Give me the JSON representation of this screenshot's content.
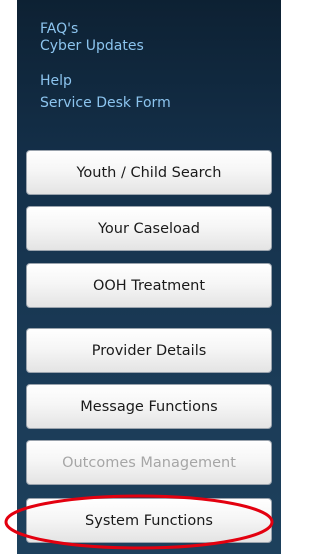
{
  "links": [
    {
      "label": "FAQ's"
    },
    {
      "label": "Cyber Updates"
    },
    {
      "label": "Help"
    },
    {
      "label": "Service Desk Form"
    }
  ],
  "menu": [
    {
      "label": "Youth / Child Search",
      "enabled": true
    },
    {
      "label": "Your Caseload",
      "enabled": true
    },
    {
      "label": "OOH Treatment",
      "enabled": true
    },
    {
      "label": "Provider Details",
      "enabled": true
    },
    {
      "label": "Message Functions",
      "enabled": true
    },
    {
      "label": "Outcomes Management",
      "enabled": false
    },
    {
      "label": "System Functions",
      "enabled": true
    }
  ],
  "colors": {
    "panel": "#14304a",
    "link": "#8cc4ee",
    "highlight": "#e3000f",
    "disabled_text": "#a6a6a6"
  }
}
